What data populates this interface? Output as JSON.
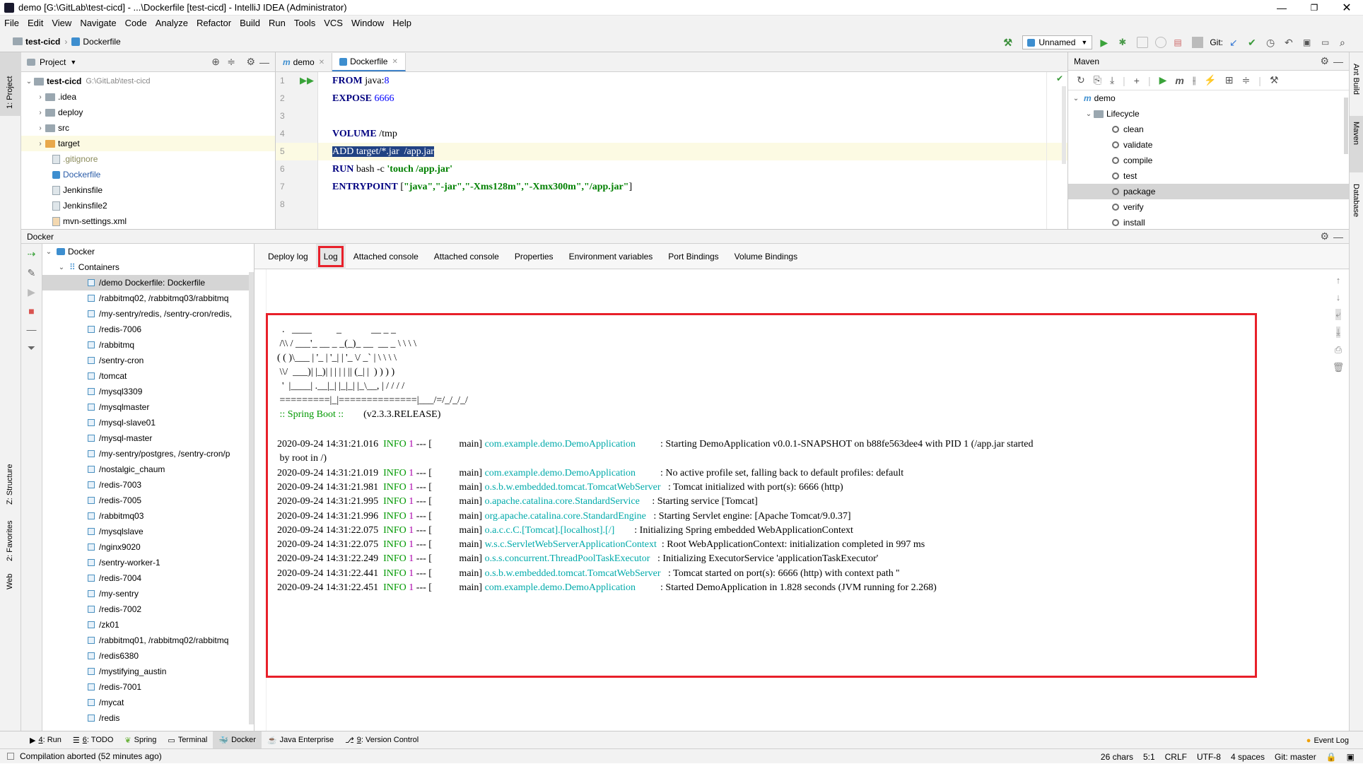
{
  "window": {
    "title": "demo [G:\\GitLab\\test-cicd] - ...\\Dockerfile [test-cicd] - IntelliJ IDEA (Administrator)"
  },
  "menu": [
    "File",
    "Edit",
    "View",
    "Navigate",
    "Code",
    "Analyze",
    "Refactor",
    "Build",
    "Run",
    "Tools",
    "VCS",
    "Window",
    "Help"
  ],
  "breadcrumb": {
    "project": "test-cicd",
    "file": "Dockerfile"
  },
  "toolbar": {
    "run_config": "Unnamed",
    "git_label": "Git:"
  },
  "project_panel": {
    "title": "Project",
    "root": "test-cicd",
    "root_path": "G:\\GitLab\\test-cicd",
    "items": [
      ".idea",
      "deploy",
      "src",
      "target",
      ".gitignore",
      "Dockerfile",
      "Jenkinsfile",
      "Jenkinsfile2",
      "mvn-settings.xml"
    ]
  },
  "editor": {
    "tabs": [
      "demo",
      "Dockerfile"
    ],
    "line_numbers": [
      "1",
      "2",
      "3",
      "4",
      "5",
      "6",
      "7",
      "8"
    ],
    "lines": {
      "l1_kw": "FROM",
      "l1_rest": " java:",
      "l1_num": "8",
      "l2_kw": "EXPOSE",
      "l2_num": " 6666",
      "l4_kw": "VOLUME",
      "l4_rest": " /tmp",
      "l5_sel": "ADD target/*.jar  /app.jar",
      "l6_kw": "RUN",
      "l6_rest": " bash -c ",
      "l6_str": "'touch /app.jar'",
      "l7_kw": "ENTRYPOINT",
      "l7_rest": " [",
      "l7_str": "\"java\",\"-jar\",\"-Xms128m\",\"-Xmx300m\",\"/app.jar\"",
      "l7_end": "]"
    }
  },
  "maven": {
    "title": "Maven",
    "root": "demo",
    "lifecycle": "Lifecycle",
    "phases": [
      "clean",
      "validate",
      "compile",
      "test",
      "package",
      "verify",
      "install"
    ]
  },
  "docker": {
    "title": "Docker",
    "root": "Docker",
    "containers_label": "Containers",
    "containers": [
      "/demo Dockerfile: Dockerfile",
      "/rabbitmq02, /rabbitmq03/rabbitmq",
      "/my-sentry/redis, /sentry-cron/redis,",
      "/redis-7006",
      "/rabbitmq",
      "/sentry-cron",
      "/tomcat",
      "/mysql3309",
      "/mysqlmaster",
      "/mysql-slave01",
      "/mysql-master",
      "/my-sentry/postgres, /sentry-cron/p",
      "/nostalgic_chaum",
      "/redis-7003",
      "/redis-7005",
      "/rabbitmq03",
      "/mysqlslave",
      "/nginx9020",
      "/sentry-worker-1",
      "/redis-7004",
      "/my-sentry",
      "/redis-7002",
      "/zk01",
      "/rabbitmq01, /rabbitmq02/rabbitmq",
      "/redis6380",
      "/mystifying_austin",
      "/redis-7001",
      "/mycat",
      "/redis"
    ],
    "tabs": [
      "Deploy log",
      "Log",
      "Attached console",
      "Attached console",
      "Properties",
      "Environment variables",
      "Port Bindings",
      "Volume Bindings"
    ],
    "banner": [
      "  .   ____          _            __ _ _",
      " /\\\\ / ___'_ __ _ _(_)_ __  __ _ \\ \\ \\ \\",
      "( ( )\\___ | '_ | '_| | '_ \\/ _` | \\ \\ \\ \\",
      " \\\\/  ___)| |_)| | | | | || (_| |  ) ) ) )",
      "  '  |____| .__|_| |_|_| |_\\__, | / / / /",
      " =========|_|==============|___/=/_/_/_/"
    ],
    "boot_label": " :: Spring Boot :: ",
    "boot_version": "       (v2.3.3.RELEASE)",
    "logs": [
      {
        "ts": "2020-09-24 14:31:21.016",
        "lvl": "INFO",
        "pid": "1",
        "sep": " --- [           main] ",
        "cls": "com.example.demo.DemoApplication        ",
        "msg": "  : Starting DemoApplication v0.0.1-SNAPSHOT on b88fe563dee4 with PID 1 (/app.jar started"
      },
      {
        "ts": "",
        "lvl": "",
        "pid": "",
        "sep": "",
        "cls": "",
        "msg": " by root in /)"
      },
      {
        "ts": "2020-09-24 14:31:21.019",
        "lvl": "INFO",
        "pid": "1",
        "sep": " --- [           main] ",
        "cls": "com.example.demo.DemoApplication        ",
        "msg": "  : No active profile set, falling back to default profiles: default"
      },
      {
        "ts": "2020-09-24 14:31:21.981",
        "lvl": "INFO",
        "pid": "1",
        "sep": " --- [           main] ",
        "cls": "o.s.b.w.embedded.tomcat.TomcatWebServer ",
        "msg": "  : Tomcat initialized with port(s): 6666 (http)"
      },
      {
        "ts": "2020-09-24 14:31:21.995",
        "lvl": "INFO",
        "pid": "1",
        "sep": " --- [           main] ",
        "cls": "o.apache.catalina.core.StandardService   ",
        "msg": "  : Starting service [Tomcat]"
      },
      {
        "ts": "2020-09-24 14:31:21.996",
        "lvl": "INFO",
        "pid": "1",
        "sep": " --- [           main] ",
        "cls": "org.apache.catalina.core.StandardEngine ",
        "msg": "  : Starting Servlet engine: [Apache Tomcat/9.0.37]"
      },
      {
        "ts": "2020-09-24 14:31:22.075",
        "lvl": "INFO",
        "pid": "1",
        "sep": " --- [           main] ",
        "cls": "o.a.c.c.C.[Tomcat].[localhost].[/]      ",
        "msg": "  : Initializing Spring embedded WebApplicationContext"
      },
      {
        "ts": "2020-09-24 14:31:22.075",
        "lvl": "INFO",
        "pid": "1",
        "sep": " --- [           main] ",
        "cls": "w.s.c.ServletWebServerApplicationContext",
        "msg": "  : Root WebApplicationContext: initialization completed in 997 ms"
      },
      {
        "ts": "2020-09-24 14:31:22.249",
        "lvl": "INFO",
        "pid": "1",
        "sep": " --- [           main] ",
        "cls": "o.s.s.concurrent.ThreadPoolTaskExecutor ",
        "msg": "  : Initializing ExecutorService 'applicationTaskExecutor'"
      },
      {
        "ts": "2020-09-24 14:31:22.441",
        "lvl": "INFO",
        "pid": "1",
        "sep": " --- [           main] ",
        "cls": "o.s.b.w.embedded.tomcat.TomcatWebServer ",
        "msg": "  : Tomcat started on port(s): 6666 (http) with context path ''"
      },
      {
        "ts": "2020-09-24 14:31:22.451",
        "lvl": "INFO",
        "pid": "1",
        "sep": " --- [           main] ",
        "cls": "com.example.demo.DemoApplication        ",
        "msg": "  : Started DemoApplication in 1.828 seconds (JVM running for 2.268)"
      }
    ]
  },
  "bottom_tools": [
    {
      "key": "4",
      "label": ": Run"
    },
    {
      "key": "6",
      "label": ": TODO"
    },
    {
      "key": "",
      "label": "Spring"
    },
    {
      "key": "",
      "label": "Terminal"
    },
    {
      "key": "",
      "label": "Docker"
    },
    {
      "key": "",
      "label": "Java Enterprise"
    },
    {
      "key": "9",
      "label": ": Version Control"
    }
  ],
  "event_log": "Event Log",
  "status": {
    "message": "Compilation aborted (52 minutes ago)",
    "chars": "26 chars",
    "pos": "5:1",
    "line_sep": "CRLF",
    "encoding": "UTF-8",
    "indent": "4 spaces",
    "branch": "Git: master"
  },
  "side_labels": {
    "project": "1: Project",
    "structure": "Z: Structure",
    "favorites": "2: Favorites",
    "web": "Web",
    "ant": "Ant Build",
    "maven": "Maven",
    "database": "Database"
  },
  "colors": {
    "accent": "#4083c9",
    "highlight_box": "#e8202a",
    "selection": "#214283"
  }
}
